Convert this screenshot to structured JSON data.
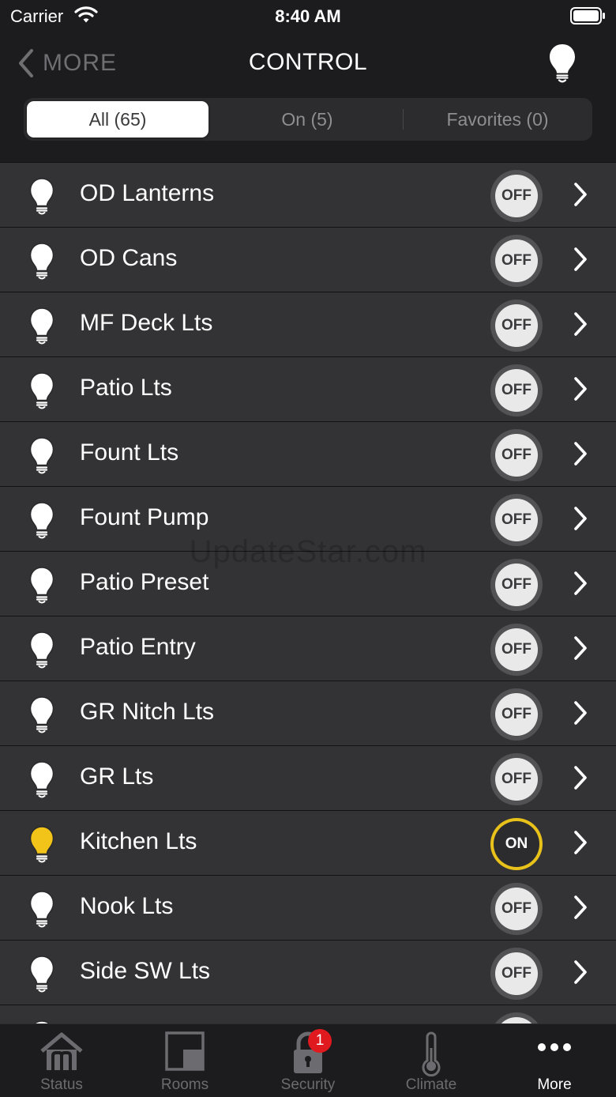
{
  "status_bar": {
    "carrier": "Carrier",
    "time": "8:40 AM"
  },
  "nav": {
    "back_label": "MORE",
    "title": "CONTROL"
  },
  "segments": [
    {
      "label": "All (65)",
      "active": true
    },
    {
      "label": "On (5)",
      "active": false
    },
    {
      "label": "Favorites (0)",
      "active": false
    }
  ],
  "devices": [
    {
      "name": "OD Lanterns",
      "state": "OFF"
    },
    {
      "name": "OD Cans",
      "state": "OFF"
    },
    {
      "name": "MF Deck Lts",
      "state": "OFF"
    },
    {
      "name": "Patio Lts",
      "state": "OFF"
    },
    {
      "name": "Fount Lts",
      "state": "OFF"
    },
    {
      "name": "Fount Pump",
      "state": "OFF"
    },
    {
      "name": "Patio Preset",
      "state": "OFF"
    },
    {
      "name": "Patio Entry",
      "state": "OFF"
    },
    {
      "name": "GR Nitch Lts",
      "state": "OFF"
    },
    {
      "name": "GR Lts",
      "state": "OFF"
    },
    {
      "name": "Kitchen Lts",
      "state": "ON"
    },
    {
      "name": "Nook Lts",
      "state": "OFF"
    },
    {
      "name": "Side SW Lts",
      "state": "OFF"
    }
  ],
  "tabs": [
    {
      "label": "Status",
      "icon": "home-icon",
      "active": false
    },
    {
      "label": "Rooms",
      "icon": "rooms-icon",
      "active": false
    },
    {
      "label": "Security",
      "icon": "lock-icon",
      "active": false,
      "badge": "1"
    },
    {
      "label": "Climate",
      "icon": "thermometer-icon",
      "active": false
    },
    {
      "label": "More",
      "icon": "ellipsis-icon",
      "active": true
    }
  ],
  "watermark": "UpdateStar.com",
  "colors": {
    "on_ring": "#e8c21a",
    "on_bulb": "#f2c318",
    "badge": "#e0191e",
    "background": "#1c1c1e",
    "row": "#333335"
  }
}
